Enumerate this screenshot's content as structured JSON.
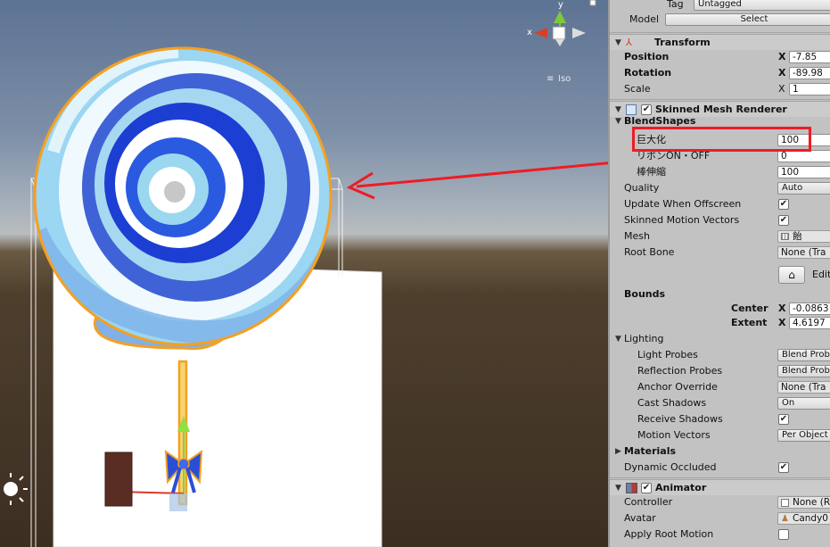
{
  "scene": {
    "gizmo": {
      "x_label": "x",
      "y_label": "y",
      "mode_label": "Iso"
    }
  },
  "inspector": {
    "tag": {
      "label": "Tag",
      "value": "Untagged"
    },
    "model": {
      "label": "Model",
      "button": "Select"
    },
    "transform": {
      "title": "Transform",
      "position": {
        "label": "Position",
        "axis": "X",
        "value": "-7.85"
      },
      "rotation": {
        "label": "Rotation",
        "axis": "X",
        "value": "-89.98"
      },
      "scale": {
        "label": "Scale",
        "axis": "X",
        "value": "1"
      }
    },
    "smr": {
      "title": "Skinned Mesh Renderer",
      "blendshapes_label": "BlendShapes",
      "shapes": [
        {
          "label": "巨大化",
          "value": "100"
        },
        {
          "label": "リボンON・OFF",
          "value": "0"
        },
        {
          "label": "棒伸縮",
          "value": "100"
        }
      ],
      "quality": {
        "label": "Quality",
        "value": "Auto"
      },
      "update_offscreen": {
        "label": "Update When Offscreen",
        "checked": "✔"
      },
      "motion_vectors": {
        "label": "Skinned Motion Vectors",
        "checked": "✔"
      },
      "mesh": {
        "label": "Mesh",
        "value": "飴"
      },
      "root_bone": {
        "label": "Root Bone",
        "value": "None (Tra"
      },
      "edit_label": "Edit",
      "bounds": {
        "label": "Bounds",
        "center_label": "Center",
        "center_axis": "X",
        "center_value": "-0.0863",
        "extent_label": "Extent",
        "extent_axis": "X",
        "extent_value": "4.6197"
      }
    },
    "lighting": {
      "title": "Lighting",
      "light_probes": {
        "label": "Light Probes",
        "value": "Blend Prob"
      },
      "reflection_probes": {
        "label": "Reflection Probes",
        "value": "Blend Prob"
      },
      "anchor_override": {
        "label": "Anchor Override",
        "value": "None (Tra"
      },
      "cast_shadows": {
        "label": "Cast Shadows",
        "value": "On"
      },
      "receive_shadows": {
        "label": "Receive Shadows",
        "checked": "✔"
      },
      "motion_vectors": {
        "label": "Motion Vectors",
        "value": "Per Object"
      }
    },
    "materials_label": "Materials",
    "dynamic_occluded": {
      "label": "Dynamic Occluded",
      "checked": "✔"
    },
    "animator": {
      "title": "Animator",
      "controller": {
        "label": "Controller",
        "value": "None (R"
      },
      "avatar": {
        "label": "Avatar",
        "value": "Candy0"
      },
      "apply_root_motion": {
        "label": "Apply Root Motion"
      }
    }
  },
  "colors": {
    "accent": "#ee1c25",
    "selection": "#f4a023"
  }
}
